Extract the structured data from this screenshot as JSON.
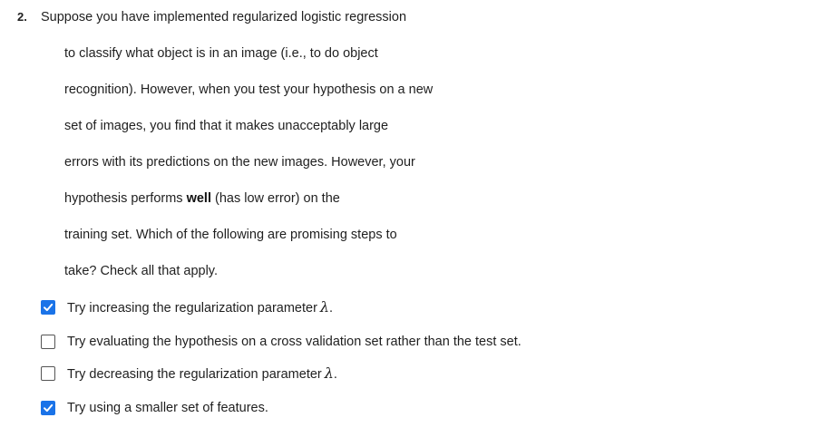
{
  "question": {
    "number": "2.",
    "lines": [
      "Suppose you have implemented regularized logistic regression",
      "to classify what object is in an image (i.e., to do object",
      "recognition). However, when you test your hypothesis on a new",
      "set of images, you find that it makes unacceptably large",
      "errors with its predictions on the new images.  However, your"
    ],
    "line6": {
      "before": "hypothesis performs ",
      "bold": "well",
      "after": " (has low error) on the"
    },
    "line7": "training set. Which of the following are promising steps to",
    "line8": "take? Check all that apply."
  },
  "options": [
    {
      "text": "Try increasing the regularization parameter",
      "symbol": "λ",
      "suffix": ".",
      "checked": true
    },
    {
      "text": "Try evaluating the hypothesis on a cross validation set rather than the test set.",
      "symbol": "",
      "suffix": "",
      "checked": false
    },
    {
      "text": "Try decreasing the regularization parameter",
      "symbol": "λ",
      "suffix": ".",
      "checked": false
    },
    {
      "text": "Try using a smaller set of features.",
      "symbol": "",
      "suffix": "",
      "checked": true
    }
  ],
  "colors": {
    "checkbox_checked": "#1a73e8",
    "checkbox_border": "#555555"
  },
  "icons": {
    "checked": "checkmark-icon"
  }
}
